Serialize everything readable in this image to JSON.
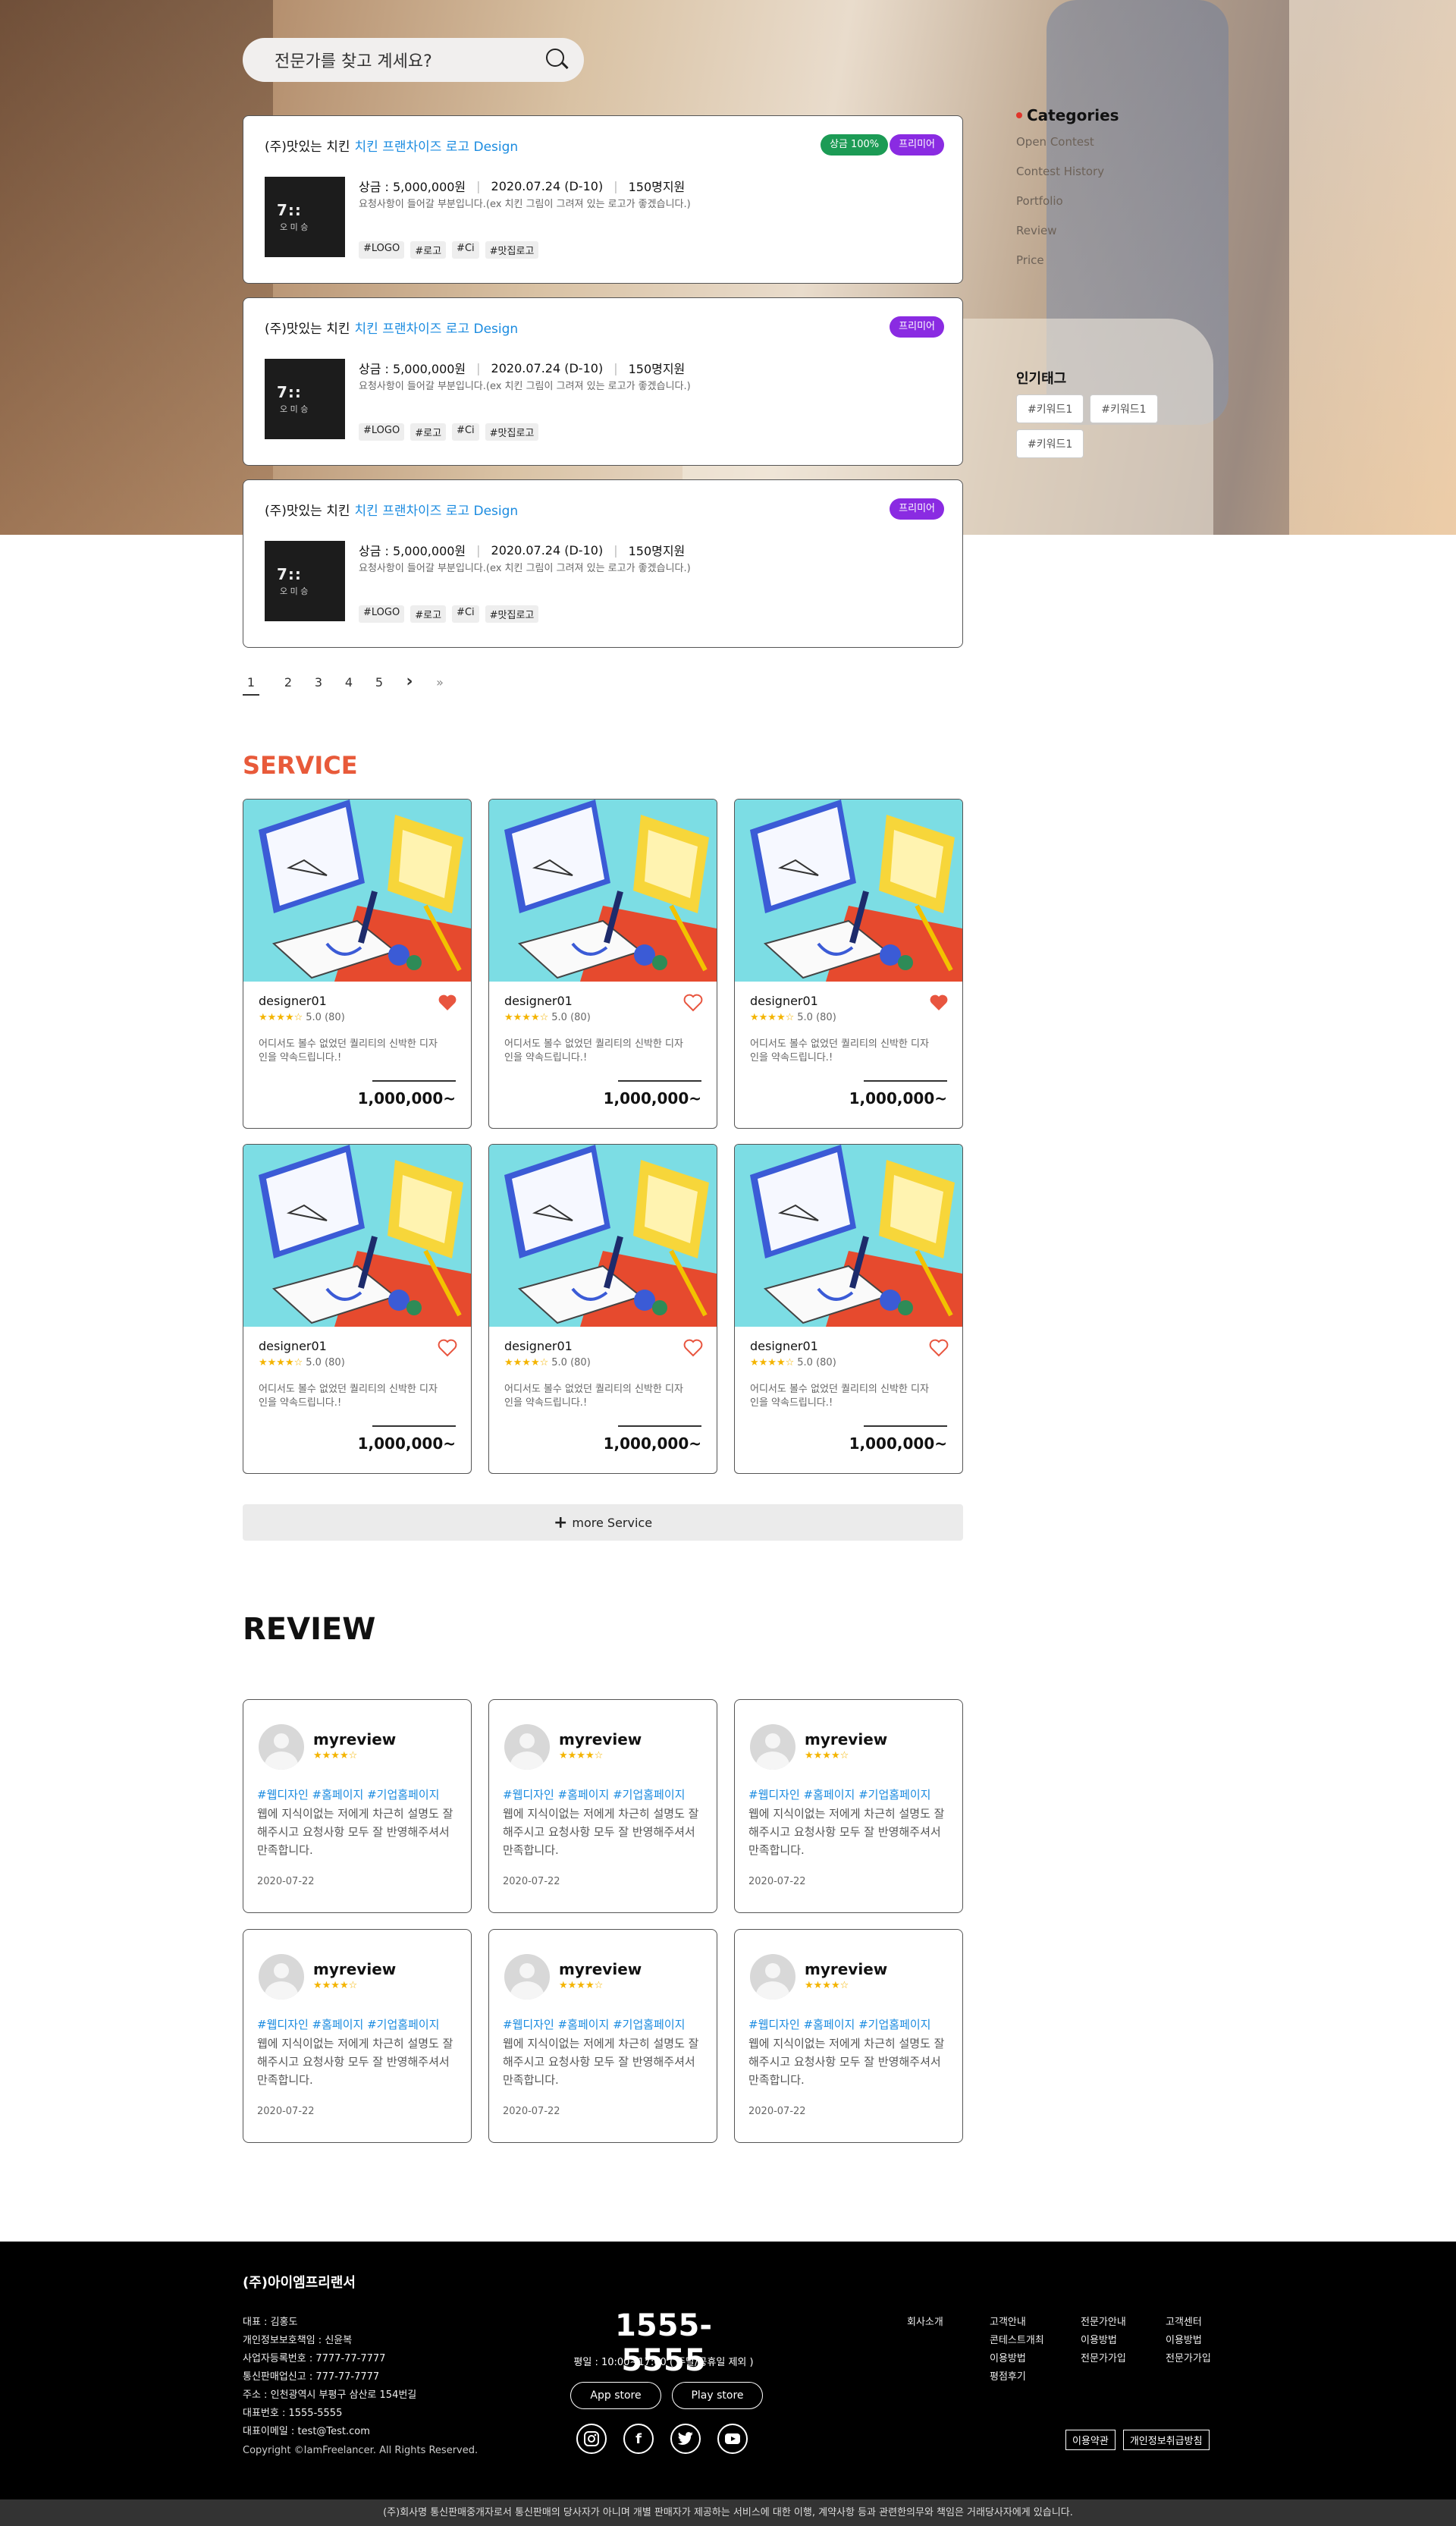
{
  "search": {
    "placeholder": "전문가를 찾고 계세요?"
  },
  "contests": [
    {
      "company": "(주)맛있는 치킨",
      "title": "치킨 프랜차이즈 로고 Design",
      "badges": [
        "상금 100%",
        "프리미어"
      ],
      "thumb_logo": "7::",
      "thumb_sub": "오 미 승",
      "prize": "상금 : 5,000,000원",
      "date": "2020.07.24 (D-10)",
      "applicants": "150명지원",
      "desc": "요청사항이 들어갈 부분입니다.(ex 치킨 그림이 그려져 있는 로고가 좋겠습니다.)",
      "tags": [
        "#LOGO",
        "#로고",
        "#Ci",
        "#맛집로고"
      ]
    },
    {
      "company": "(주)맛있는 치킨",
      "title": "치킨 프랜차이즈 로고 Design",
      "badges": [
        "프리미어"
      ],
      "thumb_logo": "7::",
      "thumb_sub": "오 미 승",
      "prize": "상금 : 5,000,000원",
      "date": "2020.07.24 (D-10)",
      "applicants": "150명지원",
      "desc": "요청사항이 들어갈 부분입니다.(ex 치킨 그림이 그려져 있는 로고가 좋겠습니다.)",
      "tags": [
        "#LOGO",
        "#로고",
        "#Ci",
        "#맛집로고"
      ]
    },
    {
      "company": "(주)맛있는 치킨",
      "title": "치킨 프랜차이즈 로고 Design",
      "badges": [
        "프리미어"
      ],
      "thumb_logo": "7::",
      "thumb_sub": "오 미 승",
      "prize": "상금 : 5,000,000원",
      "date": "2020.07.24 (D-10)",
      "applicants": "150명지원",
      "desc": "요청사항이 들어갈 부분입니다.(ex 치킨 그림이 그려져 있는 로고가 좋겠습니다.)",
      "tags": [
        "#LOGO",
        "#로고",
        "#Ci",
        "#맛집로고"
      ]
    }
  ],
  "sidebar": {
    "categories_title": "Categories",
    "items": [
      "Open Contest",
      "Contest History",
      "Portfolio",
      "Review",
      "Price"
    ],
    "popular_title": "인기태그",
    "keywords": [
      "#키워드1",
      "#키워드1",
      "#키워드1"
    ]
  },
  "pagination": {
    "pages": [
      "1",
      "2",
      "3",
      "4",
      "5"
    ],
    "current": "1",
    "next": "›",
    "last": "»"
  },
  "service": {
    "title": "SERVICE",
    "cards": [
      {
        "name": "designer01",
        "stars": "★★★★☆",
        "rating": "5.0 (80)",
        "liked": true,
        "desc": "어디서도 볼수 없었던 퀄리티의 신박한 디자인을 약속드립니다.!",
        "price": "1,000,000~"
      },
      {
        "name": "designer01",
        "stars": "★★★★☆",
        "rating": "5.0 (80)",
        "liked": false,
        "desc": "어디서도 볼수 없었던 퀄리티의 신박한 디자인을 약속드립니다.!",
        "price": "1,000,000~"
      },
      {
        "name": "designer01",
        "stars": "★★★★☆",
        "rating": "5.0 (80)",
        "liked": true,
        "desc": "어디서도 볼수 없었던 퀄리티의 신박한 디자인을 약속드립니다.!",
        "price": "1,000,000~"
      },
      {
        "name": "designer01",
        "stars": "★★★★☆",
        "rating": "5.0 (80)",
        "liked": false,
        "desc": "어디서도 볼수 없었던 퀄리티의 신박한 디자인을 약속드립니다.!",
        "price": "1,000,000~"
      },
      {
        "name": "designer01",
        "stars": "★★★★☆",
        "rating": "5.0 (80)",
        "liked": false,
        "desc": "어디서도 볼수 없었던 퀄리티의 신박한 디자인을 약속드립니다.!",
        "price": "1,000,000~"
      },
      {
        "name": "designer01",
        "stars": "★★★★☆",
        "rating": "5.0 (80)",
        "liked": false,
        "desc": "어디서도 볼수 없었던 퀄리티의 신박한 디자인을 약속드립니다.!",
        "price": "1,000,000~"
      }
    ],
    "more_label": "more Service"
  },
  "review": {
    "title": "REVIEW",
    "cards": [
      {
        "name": "myreview",
        "stars": "★★★★☆",
        "hashtags": "#웹디자인 #홈페이지 #기업홈페이지",
        "body": "웹에 지식이없는 저에게 차근히 설명도 잘해주시고 요청사항 모두 잘 반영해주셔서 만족합니다.",
        "date": "2020-07-22"
      },
      {
        "name": "myreview",
        "stars": "★★★★☆",
        "hashtags": "#웹디자인 #홈페이지 #기업홈페이지",
        "body": "웹에 지식이없는 저에게 차근히 설명도 잘해주시고 요청사항 모두 잘 반영해주셔서 만족합니다.",
        "date": "2020-07-22"
      },
      {
        "name": "myreview",
        "stars": "★★★★☆",
        "hashtags": "#웹디자인 #홈페이지 #기업홈페이지",
        "body": "웹에 지식이없는 저에게 차근히 설명도 잘해주시고 요청사항 모두 잘 반영해주셔서 만족합니다.",
        "date": "2020-07-22"
      },
      {
        "name": "myreview",
        "stars": "★★★★☆",
        "hashtags": "#웹디자인 #홈페이지 #기업홈페이지",
        "body": "웹에 지식이없는 저에게 차근히 설명도 잘해주시고 요청사항 모두 잘 반영해주셔서 만족합니다.",
        "date": "2020-07-22"
      },
      {
        "name": "myreview",
        "stars": "★★★★☆",
        "hashtags": "#웹디자인 #홈페이지 #기업홈페이지",
        "body": "웹에 지식이없는 저에게 차근히 설명도 잘해주시고 요청사항 모두 잘 반영해주셔서 만족합니다.",
        "date": "2020-07-22"
      },
      {
        "name": "myreview",
        "stars": "★★★★☆",
        "hashtags": "#웹디자인 #홈페이지 #기업홈페이지",
        "body": "웹에 지식이없는 저에게 차근히 설명도 잘해주시고 요청사항 모두 잘 반영해주셔서 만족합니다.",
        "date": "2020-07-22"
      }
    ]
  },
  "footer": {
    "brand": "(주)아이엠프리랜서",
    "info": [
      "대표 : 김홍도",
      "개인정보보호책임 : 신윤복",
      "사업자등록번호 : 7777-77-7777",
      "통신판매업신고 : 777-77-7777",
      "주소 : 인천광역시 부평구 삼산로 154번길",
      "대표번호 : 1555-5555",
      "대표이메일 : test@Test.com"
    ],
    "copyright": "Copyright ©IamFreelancer. All Rights Reserved.",
    "phone": "1555-5555",
    "hours": "평일 : 10:00~17:00 ( 주말/공휴일 제외 )",
    "app_store": "App store",
    "play_store": "Play store",
    "col1": [
      "회사소개"
    ],
    "col2": [
      "고객안내",
      "콘테스트개최",
      "이용방법",
      "평점후기"
    ],
    "col3": [
      "전문가안내",
      "이용방법",
      "전문가가입"
    ],
    "col4": [
      "고객센터",
      "이용방법",
      "전문가가입"
    ],
    "terms": "이용약관",
    "privacy": "개인정보취급방침",
    "notice": "(주)회사명 통신판매중개자로서 통신판매의 당사자가 아니며 개별 판매자가 제공하는 서비스에 대한 이행, 계약사항 등과 관련한의무와 책임은 거래당사자에게 있습니다."
  },
  "colors": {
    "accent_blue": "#1a8be0",
    "premier_purple": "#8a2be2",
    "prize_green": "#1c9b55",
    "service_orange": "#e85a3a",
    "heart_red": "#e8553f",
    "star_yellow": "#f4b400"
  }
}
